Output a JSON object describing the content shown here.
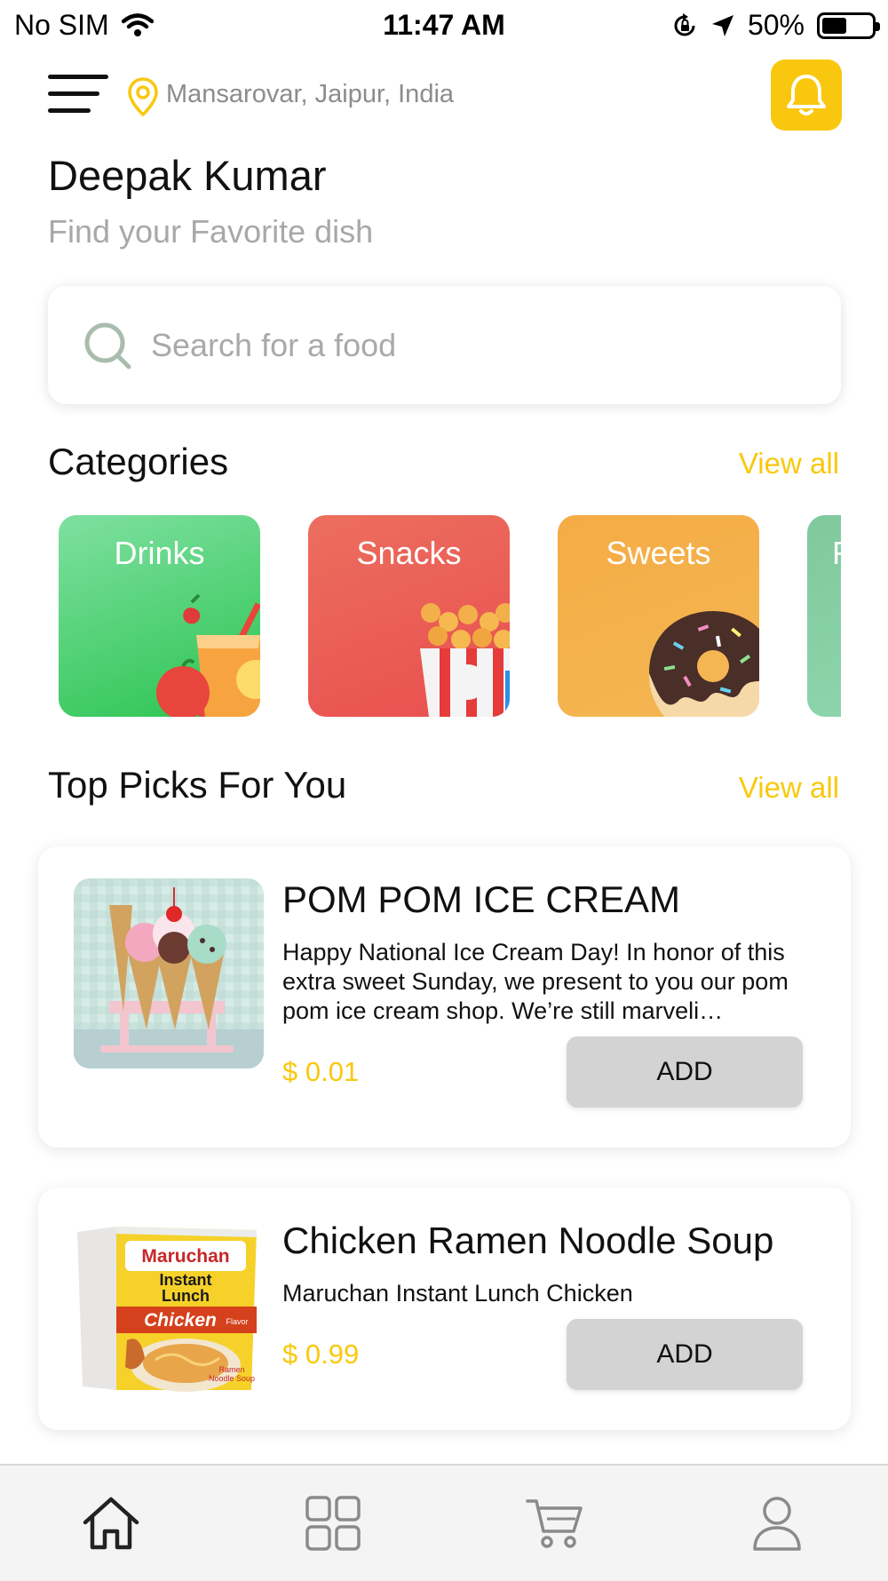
{
  "status_bar": {
    "carrier": "No SIM",
    "time": "11:47 AM",
    "battery_percent": "50%",
    "battery_level": 0.5,
    "icons": [
      "wifi-icon",
      "orientation-lock-icon",
      "location-arrow-icon",
      "battery-icon"
    ]
  },
  "header": {
    "location": "Mansarovar, Jaipur, India",
    "icons": [
      "menu-icon",
      "location-pin-icon",
      "bell-icon"
    ]
  },
  "greeting": {
    "name": "Deepak Kumar",
    "subtitle": "Find your Favorite dish"
  },
  "search": {
    "placeholder": "Search for a food",
    "value": ""
  },
  "categories": {
    "title": "Categories",
    "view_all": "View all",
    "items": [
      {
        "label": "Drinks",
        "color": "#3dcc5c"
      },
      {
        "label": "Snacks",
        "color": "#ec5c58"
      },
      {
        "label": "Sweets",
        "color": "#f5ac45"
      },
      {
        "label": "F",
        "color": "#7fcc9e"
      }
    ]
  },
  "top_picks": {
    "title": "Top Picks For You",
    "view_all": "View all",
    "products": [
      {
        "name": "POM POM ICE CREAM",
        "description": "Happy National Ice Cream Day! In honor of this extra sweet Sunday, we present to you our pom pom ice cream shop. We’re still marveli…",
        "price": "$ 0.01",
        "button": "ADD"
      },
      {
        "name": "Chicken Ramen Noodle Soup",
        "description": "Maruchan Instant Lunch Chicken",
        "price": "$ 0.99",
        "button": "ADD",
        "package_text": {
          "brand": "Maruchan",
          "line1": "Instant",
          "line2": "Lunch",
          "flavor": "Chicken",
          "flavor_suffix": "Flavor",
          "tag1": "Ramen",
          "tag2": "Noodle Soup"
        }
      }
    ]
  },
  "tabbar": {
    "tabs": [
      "home-icon",
      "grid-icon",
      "cart-icon",
      "profile-icon"
    ]
  },
  "colors": {
    "accent": "#f9c80e",
    "button_gray": "#d3d3d3",
    "muted_text": "#a8a8a8"
  }
}
